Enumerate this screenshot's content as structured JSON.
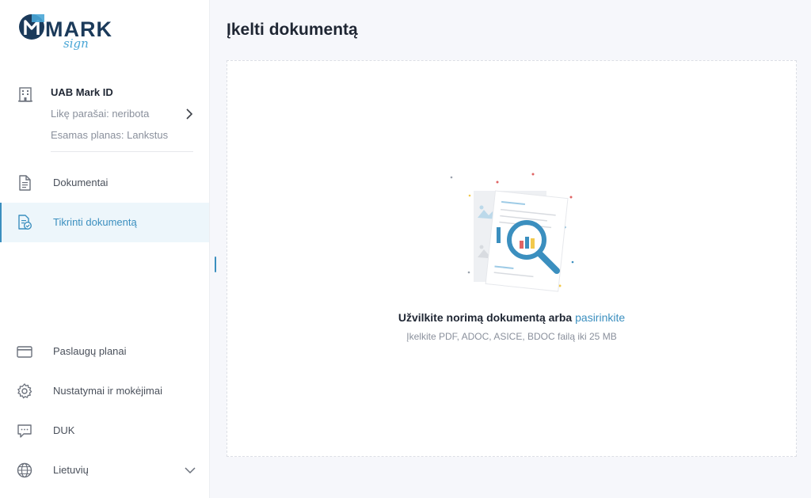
{
  "brand": {
    "logo_text": "MARK",
    "logo_script": "sign"
  },
  "company": {
    "name": "UAB Mark ID",
    "signatures_left": "Likę parašai: neribota",
    "current_plan": "Esamas planas: Lankstus"
  },
  "nav": {
    "documents": "Dokumentai",
    "verify_document": "Tikrinti dokumentą",
    "service_plans": "Paslaugų planai",
    "settings_payments": "Nustatymai ir mokėjimai",
    "faq": "DUK",
    "language": "Lietuvių"
  },
  "main": {
    "title": "Įkelti dokumentą",
    "drop_text": "Užvilkite norimą dokumentą arba",
    "drop_link": "pasirinkite",
    "drop_hint": "Įkelkite PDF, ADOC, ASICE, BDOC failą iki 25 MB"
  },
  "colors": {
    "accent": "#3b8fbf",
    "navy": "#1b3a5a",
    "active_bg": "#edf6fb",
    "page_bg": "#f6f7fb"
  },
  "icons": {
    "company": "building-icon",
    "documents": "document-icon",
    "verify": "verify-document-icon",
    "plans": "card-icon",
    "settings": "gear-icon",
    "faq": "chat-icon",
    "language": "globe-icon"
  }
}
